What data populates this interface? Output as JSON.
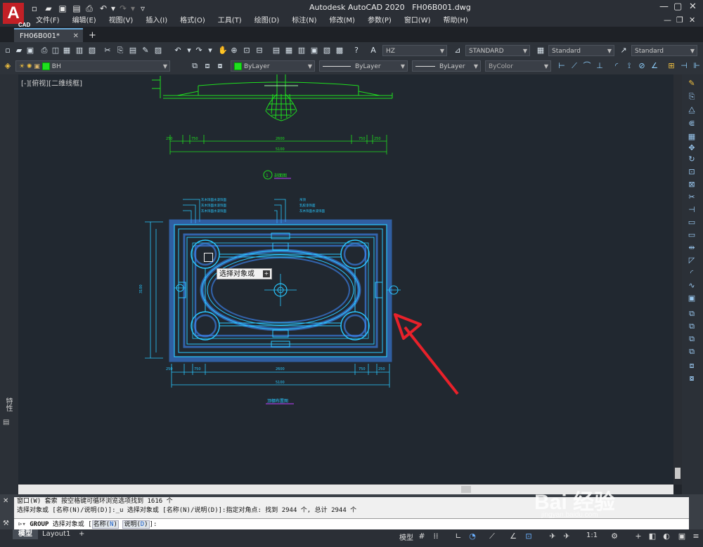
{
  "app": {
    "title": "Autodesk AutoCAD 2020",
    "filename": "FH06B001.dwg",
    "logo": "A",
    "logo_sub": "CAD"
  },
  "menus": [
    "文件(F)",
    "编辑(E)",
    "视图(V)",
    "插入(I)",
    "格式(O)",
    "工具(T)",
    "绘图(D)",
    "标注(N)",
    "修改(M)",
    "参数(P)",
    "窗口(W)",
    "帮助(H)"
  ],
  "tabs": {
    "document": "FH06B001*",
    "new_tab": "+"
  },
  "toolbar1": {
    "text_style": "HZ",
    "dim_style": "STANDARD",
    "table_style": "Standard",
    "multileader_style": "Standard"
  },
  "toolbar2": {
    "layer": "BH",
    "color": "ByLayer",
    "linetype": "ByLayer",
    "lineweight": "ByLayer",
    "plotstyle": "ByColor"
  },
  "viewport": {
    "label": "[-][俯视][二维线框]"
  },
  "drawing": {
    "elevation_tag": "剖面图",
    "elevation_num": "1",
    "plan_tag": "顶棚布置图",
    "dims_top": [
      "250",
      "750",
      "2600",
      "750",
      "250"
    ],
    "dims_total": "5100",
    "dims_bottom": [
      "250",
      "750",
      "2600",
      "750",
      "250"
    ],
    "dims_bottom_total": "5100",
    "dim_left": "3100",
    "leaders_left": [
      "灰木饰面水漆饰面",
      "灰木饰面水漆饰面",
      "灰木饰面水漆饰面"
    ],
    "leaders_right": [
      "吊顶",
      "乳胶漆饰面",
      "灰木饰面水漆饰面"
    ]
  },
  "tooltip": {
    "text": "选择对象或",
    "badge": "+"
  },
  "command": {
    "history_1": "窗口(W) 套索  按空格键可循环浏览选项找到 1616 个",
    "history_2": "选择对象或 [名称(N)/说明(D)]:_u 选择对象或 [名称(N)/说明(D)]:指定对角点: 找到 2944 个, 总计 2944 个",
    "prompt_cmd": "GROUP",
    "prompt_text": "选择对象或",
    "prompt_open": "[",
    "opt1_label": "名称(",
    "opt1_key": "N",
    "opt1_close": ")",
    "opt2_label": "说明(",
    "opt2_key": "D",
    "opt2_close": ")",
    "prompt_end": "]:"
  },
  "layout_tabs": [
    "模型",
    "Layout1",
    "+"
  ],
  "status": {
    "model_label": "模型",
    "scale": "1:1"
  },
  "side_palette": {
    "label": "特性"
  },
  "watermark": {
    "text": "Bai 经验",
    "url": "jingyan.baidu.com"
  },
  "colors": {
    "accent_cyan": "#29c7ff",
    "highlight_blue": "#3e8bff",
    "green_lines": "#1fe01f",
    "arrow_red": "#e8212a"
  }
}
